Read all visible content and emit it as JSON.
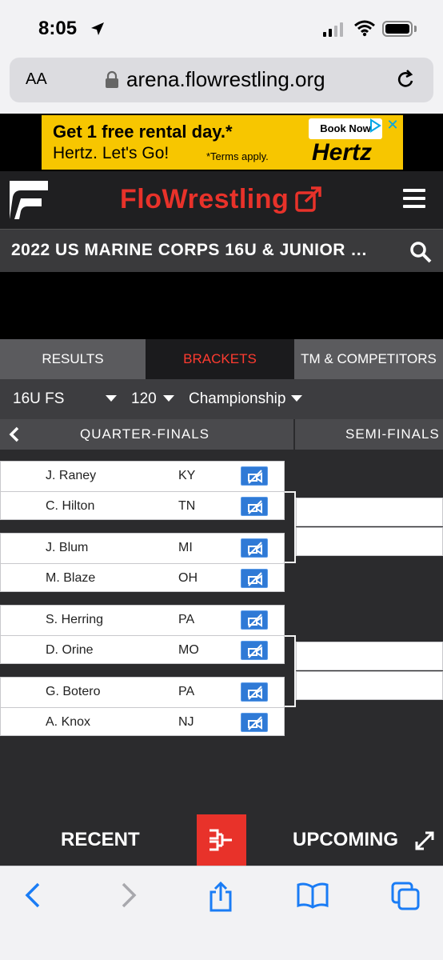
{
  "status_bar": {
    "time": "8:05"
  },
  "browser": {
    "text_size": "AA",
    "url": "arena.flowrestling.org"
  },
  "ad": {
    "line1": "Get 1 free rental day.*",
    "line2": "Hertz. Let's Go!",
    "terms": "*Terms apply.",
    "cta": "Book Now",
    "brand": "Hertz",
    "close": "✕",
    "accent_color": "#f7c600"
  },
  "header": {
    "brand": "FloWrestling",
    "brand_color": "#e8322a"
  },
  "event": {
    "title": "2022 US MARINE CORPS 16U & JUNIOR …"
  },
  "tabs": [
    {
      "label": "RESULTS"
    },
    {
      "label": "BRACKETS",
      "active": true
    },
    {
      "label": "TM & COMPETITORS"
    }
  ],
  "filters": {
    "style": "16U FS",
    "weight": "120",
    "bracket": "Championship"
  },
  "rounds": {
    "current": "QUARTER-FINALS",
    "next": "SEMI-FINALS"
  },
  "matches": [
    {
      "top": {
        "name": "J. Raney",
        "state": "KY"
      },
      "bottom": {
        "name": "C. Hilton",
        "state": "TN"
      }
    },
    {
      "top": {
        "name": "J. Blum",
        "state": "MI"
      },
      "bottom": {
        "name": "M. Blaze",
        "state": "OH"
      }
    },
    {
      "top": {
        "name": "S. Herring",
        "state": "PA"
      },
      "bottom": {
        "name": "D. Orine",
        "state": "MO"
      }
    },
    {
      "top": {
        "name": "G. Botero",
        "state": "PA"
      },
      "bottom": {
        "name": "A. Knox",
        "state": "NJ"
      }
    }
  ],
  "bottom_nav": {
    "recent": "RECENT",
    "upcoming": "UPCOMING"
  },
  "icons": {
    "video": "video-off-icon",
    "menu": "hamburger-menu-icon",
    "search": "search-icon",
    "bracket": "bracket-icon"
  }
}
